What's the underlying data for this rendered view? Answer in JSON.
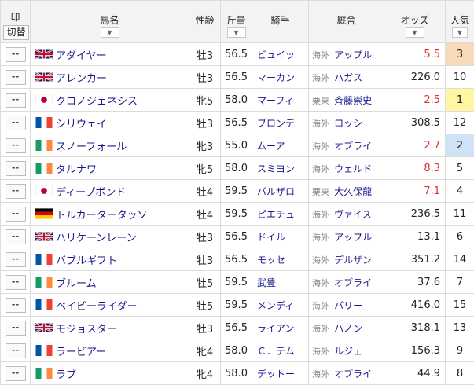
{
  "header": {
    "mark": "印",
    "toggle": "切替",
    "horse_name": "馬名",
    "sex_age": "性齢",
    "weight": "斤量",
    "jockey": "騎手",
    "stable": "厩舎",
    "odds": "オッズ",
    "popularity": "人気"
  },
  "mark_button_label": "--",
  "rows": [
    {
      "flag": "uk",
      "name": "アダイヤー",
      "sex_age": "牡3",
      "weight": "56.5",
      "jockey": "ビュイッ",
      "region": "海外",
      "trainer": "アップル",
      "odds": "5.5",
      "odds_red": true,
      "pop": "3"
    },
    {
      "flag": "uk",
      "name": "アレンカー",
      "sex_age": "牡3",
      "weight": "56.5",
      "jockey": "マーカン",
      "region": "海外",
      "trainer": "ハガス",
      "odds": "226.0",
      "odds_red": false,
      "pop": "10"
    },
    {
      "flag": "jp",
      "name": "クロノジェネシス",
      "sex_age": "牝5",
      "weight": "58.0",
      "jockey": "マーフィ",
      "region": "栗東",
      "trainer": "斉藤崇史",
      "odds": "2.5",
      "odds_red": true,
      "pop": "1"
    },
    {
      "flag": "fr",
      "name": "シリウェイ",
      "sex_age": "牡3",
      "weight": "56.5",
      "jockey": "ブロンデ",
      "region": "海外",
      "trainer": "ロッシ",
      "odds": "308.5",
      "odds_red": false,
      "pop": "12"
    },
    {
      "flag": "ie",
      "name": "スノーフォール",
      "sex_age": "牝3",
      "weight": "55.0",
      "jockey": "ムーア",
      "region": "海外",
      "trainer": "オブライ",
      "odds": "2.7",
      "odds_red": true,
      "pop": "2"
    },
    {
      "flag": "ie",
      "name": "タルナワ",
      "sex_age": "牝5",
      "weight": "58.0",
      "jockey": "スミヨン",
      "region": "海外",
      "trainer": "ウェルド",
      "odds": "8.3",
      "odds_red": true,
      "pop": "5"
    },
    {
      "flag": "jp",
      "name": "ディープボンド",
      "sex_age": "牡4",
      "weight": "59.5",
      "jockey": "バルザロ",
      "region": "栗東",
      "trainer": "大久保龍",
      "odds": "7.1",
      "odds_red": true,
      "pop": "4"
    },
    {
      "flag": "de",
      "name": "トルカータータッソ",
      "sex_age": "牡4",
      "weight": "59.5",
      "jockey": "ピエチュ",
      "region": "海外",
      "trainer": "ヴァイス",
      "odds": "236.5",
      "odds_red": false,
      "pop": "11"
    },
    {
      "flag": "uk",
      "name": "ハリケーンレーン",
      "sex_age": "牡3",
      "weight": "56.5",
      "jockey": "ドイル",
      "region": "海外",
      "trainer": "アップル",
      "odds": "13.1",
      "odds_red": false,
      "pop": "6"
    },
    {
      "flag": "fr",
      "name": "バブルギフト",
      "sex_age": "牡3",
      "weight": "56.5",
      "jockey": "モッセ",
      "region": "海外",
      "trainer": "デルザン",
      "odds": "351.2",
      "odds_red": false,
      "pop": "14"
    },
    {
      "flag": "ie",
      "name": "ブルーム",
      "sex_age": "牡5",
      "weight": "59.5",
      "jockey": "武豊",
      "region": "海外",
      "trainer": "オブライ",
      "odds": "37.6",
      "odds_red": false,
      "pop": "7"
    },
    {
      "flag": "fr",
      "name": "ベイビーライダー",
      "sex_age": "牡5",
      "weight": "59.5",
      "jockey": "メンディ",
      "region": "海外",
      "trainer": "バリー",
      "odds": "416.0",
      "odds_red": false,
      "pop": "15"
    },
    {
      "flag": "uk",
      "name": "モジョスター",
      "sex_age": "牡3",
      "weight": "56.5",
      "jockey": "ライアン",
      "region": "海外",
      "trainer": "ハノン",
      "odds": "318.1",
      "odds_red": false,
      "pop": "13"
    },
    {
      "flag": "fr",
      "name": "ラービアー",
      "sex_age": "牝4",
      "weight": "58.0",
      "jockey": "Ｃ．デム",
      "region": "海外",
      "trainer": "ルジェ",
      "odds": "156.3",
      "odds_red": false,
      "pop": "9"
    },
    {
      "flag": "ie",
      "name": "ラブ",
      "sex_age": "牝4",
      "weight": "58.0",
      "jockey": "デットー",
      "region": "海外",
      "trainer": "オブライ",
      "odds": "44.9",
      "odds_red": false,
      "pop": "8"
    }
  ],
  "colors": {
    "odds_favored": "#e03030",
    "pop_1": "#fff6a3",
    "pop_2": "#cfe2f6",
    "pop_3": "#f8d9b8"
  }
}
